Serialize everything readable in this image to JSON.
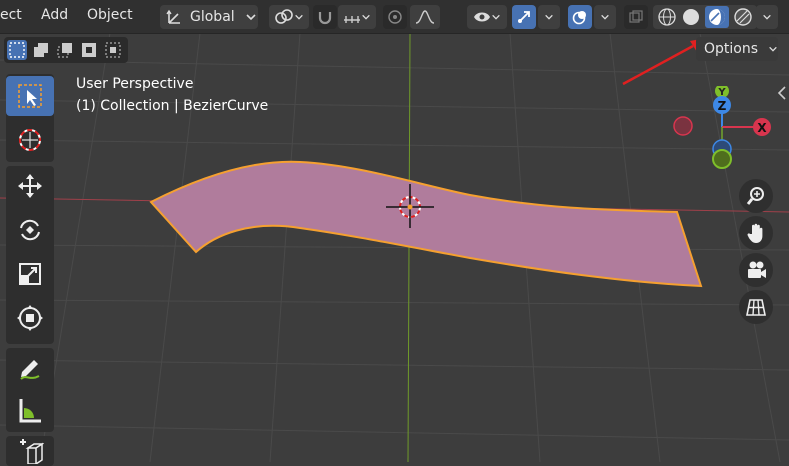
{
  "menu": {
    "items": [
      "ect",
      "Add",
      "Object"
    ]
  },
  "header": {
    "transform_orientation": "Global",
    "options_label": "Options"
  },
  "overlay": {
    "view_name": "User Perspective",
    "collection_text": "(1) Collection | BezierCurve"
  },
  "gizmo": {
    "x_label": "X",
    "y_label": "Y",
    "z_label": "Z"
  },
  "colors": {
    "viewport_bg": "#3d3d3d",
    "header_bg": "#303030",
    "active_blue": "#4772b3",
    "selection_orange": "#f5a030",
    "mesh_fill": "#b07c9c",
    "x_axis": "#d8354e",
    "y_axis": "#7fbf2a",
    "z_axis": "#3d88e6",
    "annotation_arrow": "#e02020"
  },
  "icons": {
    "toolbar": [
      "select-box-icon",
      "cursor-icon",
      "move-icon",
      "rotate-icon",
      "scale-icon",
      "transform-icon",
      "annotate-icon",
      "measure-icon",
      "add-cube-icon"
    ],
    "nav": [
      "zoom-icon",
      "pan-hand-icon",
      "camera-icon",
      "grid-ortho-icon"
    ],
    "shading": [
      "wireframe-shading-icon",
      "solid-shading-icon",
      "material-preview-icon",
      "rendered-shading-icon"
    ]
  }
}
